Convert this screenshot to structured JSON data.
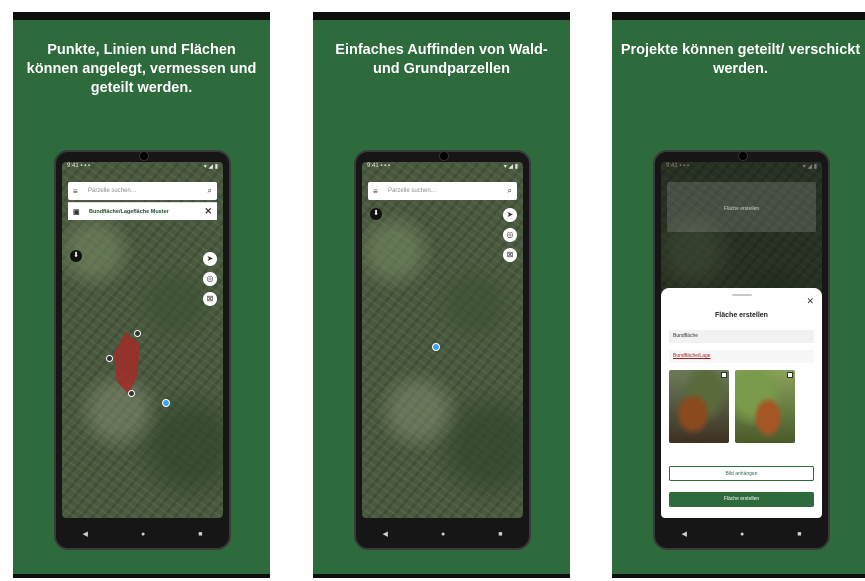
{
  "panels": [
    {
      "caption": "Punkte, Linien und Flächen können angelegt, vermessen und geteilt werden.",
      "status_left": "9:41 ▪ ▪ ▪",
      "status_right": "▾ ◢ ▮",
      "search_placeholder": "Parzelle suchen…",
      "layer_label": "Bundfläche/Lagefläche Muster",
      "nav": [
        "◀",
        "●",
        "■"
      ]
    },
    {
      "caption": "Einfaches Auffinden von Wald- und Grundparzellen",
      "status_left": "9:41 ▪ ▪ ▪",
      "status_right": "▾ ◢ ▮",
      "search_placeholder": "Parzelle suchen…",
      "nav": [
        "◀",
        "●",
        "■"
      ]
    },
    {
      "caption": "Projekte können geteilt/ verschickt werden.",
      "status_left": "9:41 ▪ ▪ ▪",
      "status_right": "▾ ◢ ▮",
      "ghost_text": "Fläche erstellen",
      "sheet": {
        "title": "Fläche erstellen",
        "field_name": "Bundfläche",
        "field_link": "Bundfläche/Lage",
        "button_outline": "Bild anhängen",
        "button_primary": "Fläche erstellen"
      },
      "nav": [
        "◀",
        "●",
        "■"
      ]
    }
  ],
  "icons": {
    "menu": "menu-icon",
    "search": "search-icon",
    "locate": "navigation-arrow-icon",
    "layers": "layers-icon",
    "measure": "measure-icon",
    "compass": "compass-icon",
    "close": "close-icon"
  },
  "colors": {
    "brand_green": "#2d6a3c",
    "polygon_red": "#a12d27",
    "gps_blue": "#3ea1f2"
  }
}
